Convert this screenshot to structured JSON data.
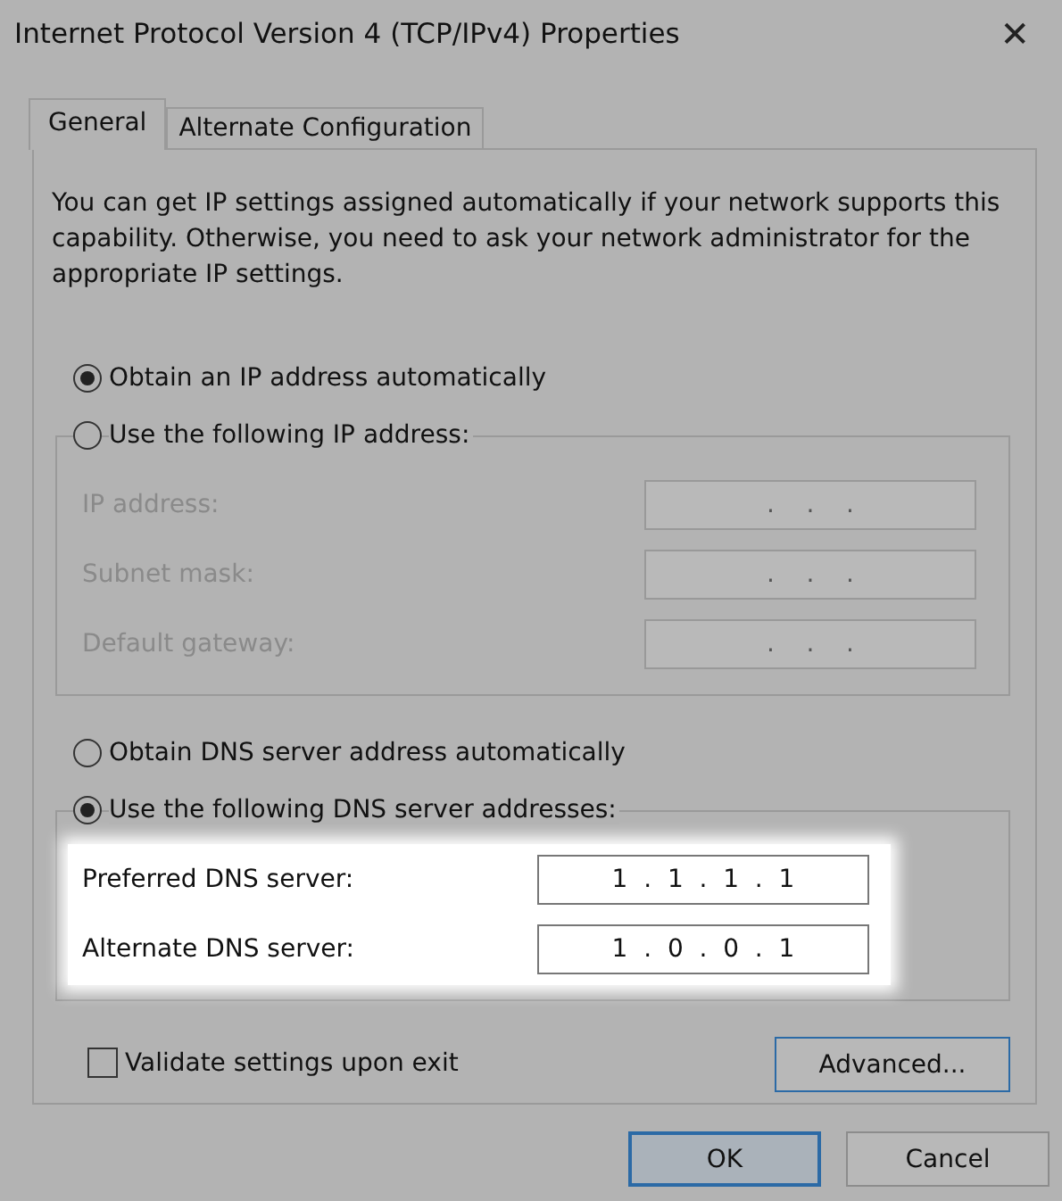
{
  "window": {
    "title": "Internet Protocol Version 4 (TCP/IPv4) Properties",
    "close": "✕"
  },
  "tabs": [
    {
      "label": "General",
      "selected": true
    },
    {
      "label": "Alternate Configuration",
      "selected": false
    }
  ],
  "description": "You can get IP settings assigned automatically if your network supports this capability. Otherwise, you need to ask your network administrator for the appropriate IP settings.",
  "ip_section": {
    "auto_option": {
      "label": "Obtain an IP address automatically",
      "selected": true
    },
    "manual_option": {
      "label": "Use the following IP address:",
      "selected": false
    },
    "disabled": true,
    "highlighted": false,
    "fields": [
      {
        "label": "IP address:",
        "value": ".    .    ."
      },
      {
        "label": "Subnet mask:",
        "value": ".    .    ."
      },
      {
        "label": "Default gateway:",
        "value": ".    .    ."
      }
    ]
  },
  "dns_section": {
    "auto_option": {
      "label": "Obtain DNS server address automatically",
      "selected": false
    },
    "manual_option": {
      "label": "Use the following DNS server addresses:",
      "selected": true
    },
    "disabled": false,
    "highlighted": true,
    "fields": [
      {
        "label": "Preferred DNS server:",
        "value": "1  .  1  .  1  .  1"
      },
      {
        "label": "Alternate DNS server:",
        "value": "1  .  0  .  0  .  1"
      }
    ]
  },
  "validate": {
    "label": "Validate settings upon exit",
    "checked": false
  },
  "advanced_button": "Advanced...",
  "buttons": [
    {
      "label": "OK",
      "default": true
    },
    {
      "label": "Cancel",
      "default": false
    }
  ]
}
